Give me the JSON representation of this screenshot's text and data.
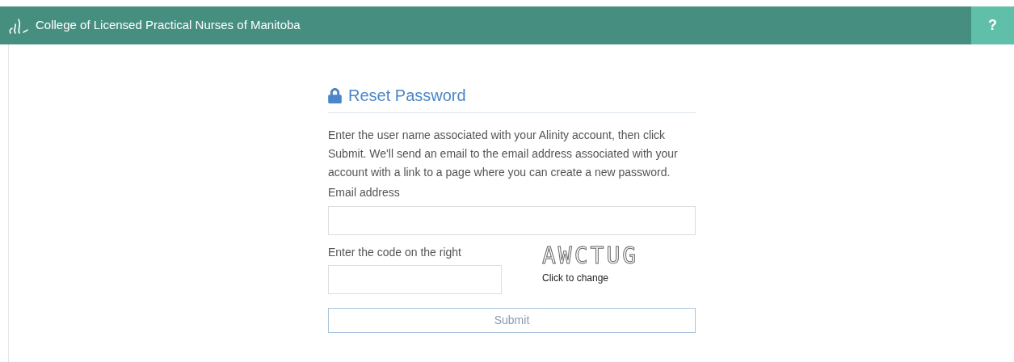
{
  "header": {
    "title": "College of Licensed Practical Nurses of Manitoba",
    "help": "?"
  },
  "form": {
    "title": "Reset Password",
    "description": "Enter the user name associated with your Alinity account, then click Submit. We'll send an email to the email address associated with your account with a link to a page where you can create a new password.",
    "email_label": "Email address",
    "code_label": "Enter the code on the right",
    "captcha": "AWCTUG",
    "captcha_hint": "Click to change",
    "submit": "Submit"
  }
}
